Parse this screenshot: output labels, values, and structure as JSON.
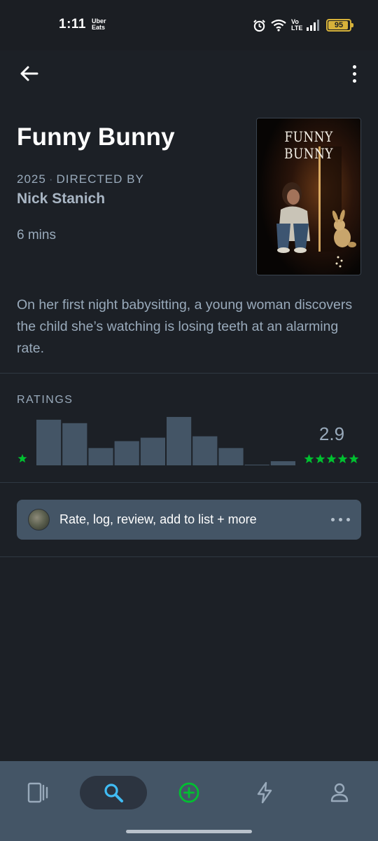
{
  "status_bar": {
    "time": "1:11",
    "app_badge": "Uber Eats",
    "network": "Vo LTE",
    "battery": "95"
  },
  "film": {
    "title": "Funny Bunny",
    "year": "2025",
    "directed_by_label": "DIRECTED BY",
    "director": "Nick Stanich",
    "runtime": "6 mins",
    "poster_title": "FUNNY BUNNY",
    "synopsis": "On her first night babysitting, a young woman discovers the child she’s watching is losing teeth at an alarming rate."
  },
  "ratings": {
    "heading": "RATINGS",
    "average": "2.9",
    "bar_color": "#445566",
    "star_color": "#00c030",
    "chart_data": {
      "type": "bar",
      "categories": [
        "0.5",
        "1",
        "1.5",
        "2",
        "2.5",
        "3",
        "3.5",
        "4",
        "4.5",
        "5"
      ],
      "values": [
        66,
        61,
        25,
        35,
        40,
        70,
        42,
        25,
        1,
        6
      ],
      "ylim": [
        0,
        75
      ]
    }
  },
  "actions": {
    "label": "Rate, log, review, add to list + more"
  },
  "bottom_nav": {
    "active_color": "#40bcf4",
    "add_color": "#00c030",
    "icons": [
      "films-icon",
      "search-icon",
      "add-icon",
      "activity-icon",
      "profile-icon"
    ]
  }
}
